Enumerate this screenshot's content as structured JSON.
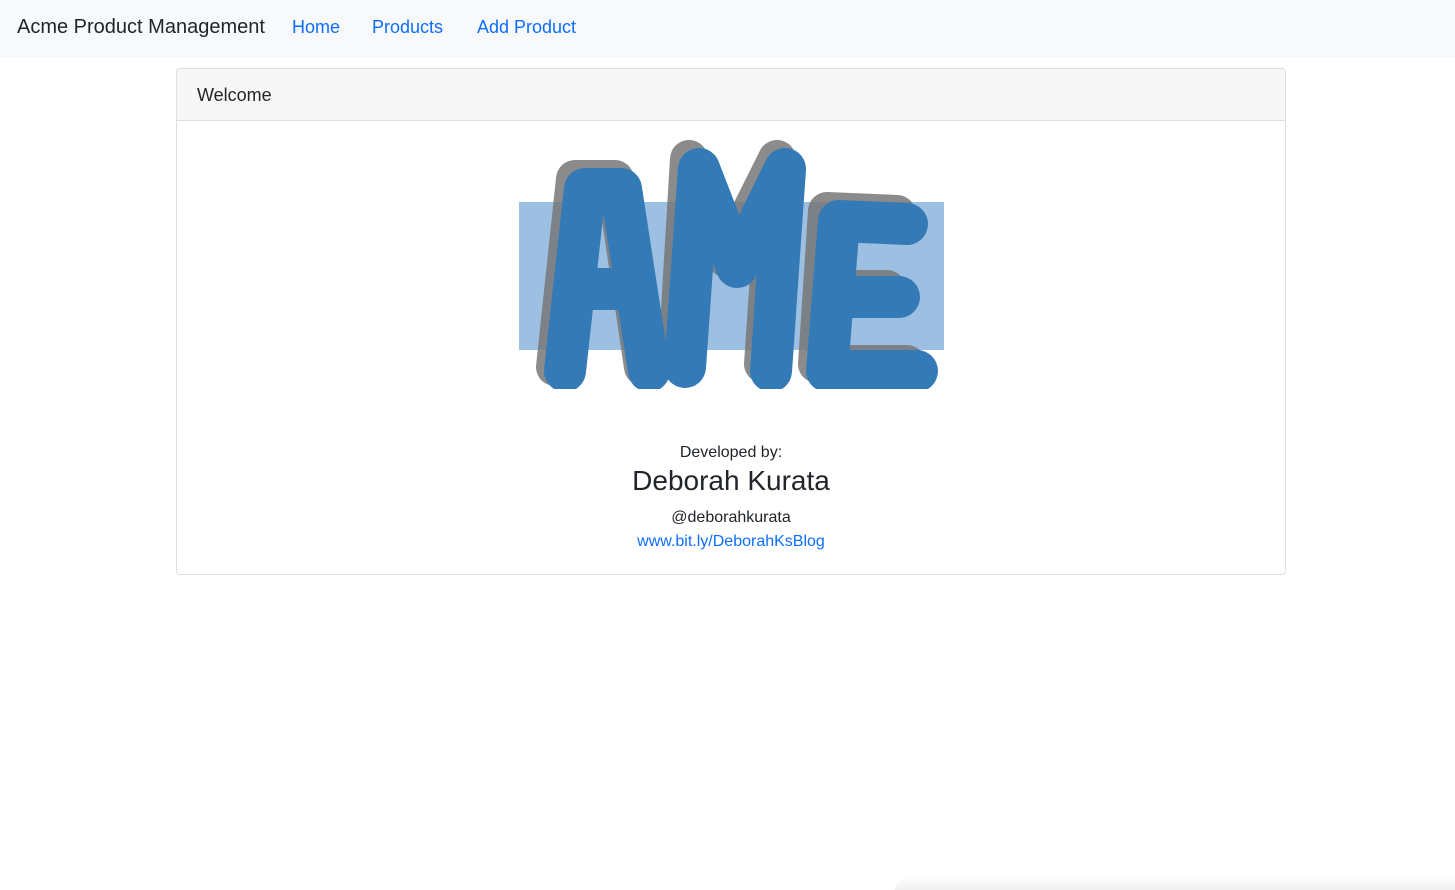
{
  "navbar": {
    "brand": "Acme Product Management",
    "links": [
      {
        "label": "Home"
      },
      {
        "label": "Products"
      },
      {
        "label": "Add Product"
      }
    ]
  },
  "card": {
    "header": "Welcome",
    "logo_text": "AcMe",
    "developed_by_label": "Developed by:",
    "developer_name": "Deborah Kurata",
    "developer_handle": "@deborahkurata",
    "developer_link": "www.bit.ly/DeborahKsBlog"
  },
  "colors": {
    "link": "#0d6efd",
    "logo_fill": "#337ab7",
    "logo_bg": "#9dc0e2",
    "logo_shadow": "#777777",
    "navbar_bg": "#f8f9fa"
  }
}
